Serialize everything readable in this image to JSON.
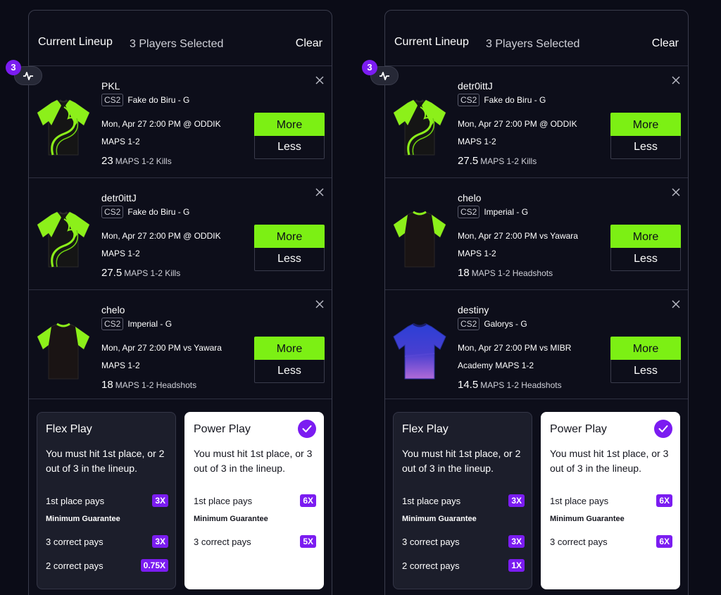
{
  "colors": {
    "accent_green": "#7cf014",
    "accent_purple": "#7b1cf1",
    "background": "#0b0c17"
  },
  "panels": [
    {
      "header": {
        "title": "Current Lineup",
        "count": "3 Players Selected",
        "clear": "Clear"
      },
      "badge": "3",
      "picks": [
        {
          "name": "PKL",
          "game": "CS2",
          "team": "Fake do Biru - G",
          "match": "Mon, Apr 27 2:00 PM @ ODDIK",
          "maps": "MAPS 1-2",
          "value": "23",
          "stat": "MAPS 1-2 Kills",
          "more": "More",
          "less": "Less",
          "jersey": "green-black"
        },
        {
          "name": "detr0ittJ",
          "game": "CS2",
          "team": "Fake do Biru - G",
          "match": "Mon, Apr 27 2:00 PM @ ODDIK",
          "maps": "MAPS 1-2",
          "value": "27.5",
          "stat": "MAPS 1-2 Kills",
          "more": "More",
          "less": "Less",
          "jersey": "green-black"
        },
        {
          "name": "chelo",
          "game": "CS2",
          "team": "Imperial - G",
          "match": "Mon, Apr 27 2:00 PM vs Yawara",
          "maps": "MAPS 1-2",
          "value": "18",
          "stat": "MAPS 1-2 Headshots",
          "more": "More",
          "less": "Less",
          "jersey": "black-green"
        }
      ],
      "flex": {
        "title": "Flex Play",
        "desc": "You must hit 1st place, or 2 out of 3 in the lineup.",
        "first_label": "1st place pays",
        "first_mult": "3X",
        "minimum": "Minimum Guarantee",
        "r2_label": "3 correct pays",
        "r2_mult": "3X",
        "r3_label": "2 correct pays",
        "r3_mult": "0.75X"
      },
      "power": {
        "title": "Power Play",
        "desc": "You must hit 1st place, or 3 out of 3 in the lineup.",
        "first_label": "1st place pays",
        "first_mult": "6X",
        "minimum": "Minimum Guarantee",
        "r2_label": "3 correct pays",
        "r2_mult": "5X"
      }
    },
    {
      "header": {
        "title": "Current Lineup",
        "count": "3 Players Selected",
        "clear": "Clear"
      },
      "badge": "3",
      "picks": [
        {
          "name": "detr0ittJ",
          "game": "CS2",
          "team": "Fake do Biru - G",
          "match": "Mon, Apr 27 2:00 PM @ ODDIK",
          "maps": "MAPS 1-2",
          "value": "27.5",
          "stat": "MAPS 1-2 Kills",
          "more": "More",
          "less": "Less",
          "jersey": "green-black"
        },
        {
          "name": "chelo",
          "game": "CS2",
          "team": "Imperial - G",
          "match": "Mon, Apr 27 2:00 PM vs Yawara",
          "maps": "MAPS 1-2",
          "value": "18",
          "stat": "MAPS 1-2 Headshots",
          "more": "More",
          "less": "Less",
          "jersey": "black-green"
        },
        {
          "name": "destiny",
          "game": "CS2",
          "team": "Galorys - G",
          "match": "Mon, Apr 27 2:00 PM vs MIBR",
          "maps": "Academy MAPS 1-2",
          "value": "14.5",
          "stat": "MAPS 1-2 Headshots",
          "more": "More",
          "less": "Less",
          "jersey": "blue-purple"
        }
      ],
      "flex": {
        "title": "Flex Play",
        "desc": "You must hit 1st place, or 2 out of 3 in the lineup.",
        "first_label": "1st place pays",
        "first_mult": "3X",
        "minimum": "Minimum Guarantee",
        "r2_label": "3 correct pays",
        "r2_mult": "3X",
        "r3_label": "2 correct pays",
        "r3_mult": "1X"
      },
      "power": {
        "title": "Power Play",
        "desc": "You must hit 1st place, or 3 out of 3 in the lineup.",
        "first_label": "1st place pays",
        "first_mult": "6X",
        "minimum": "Minimum Guarantee",
        "r2_label": "3 correct pays",
        "r2_mult": "6X"
      }
    }
  ]
}
